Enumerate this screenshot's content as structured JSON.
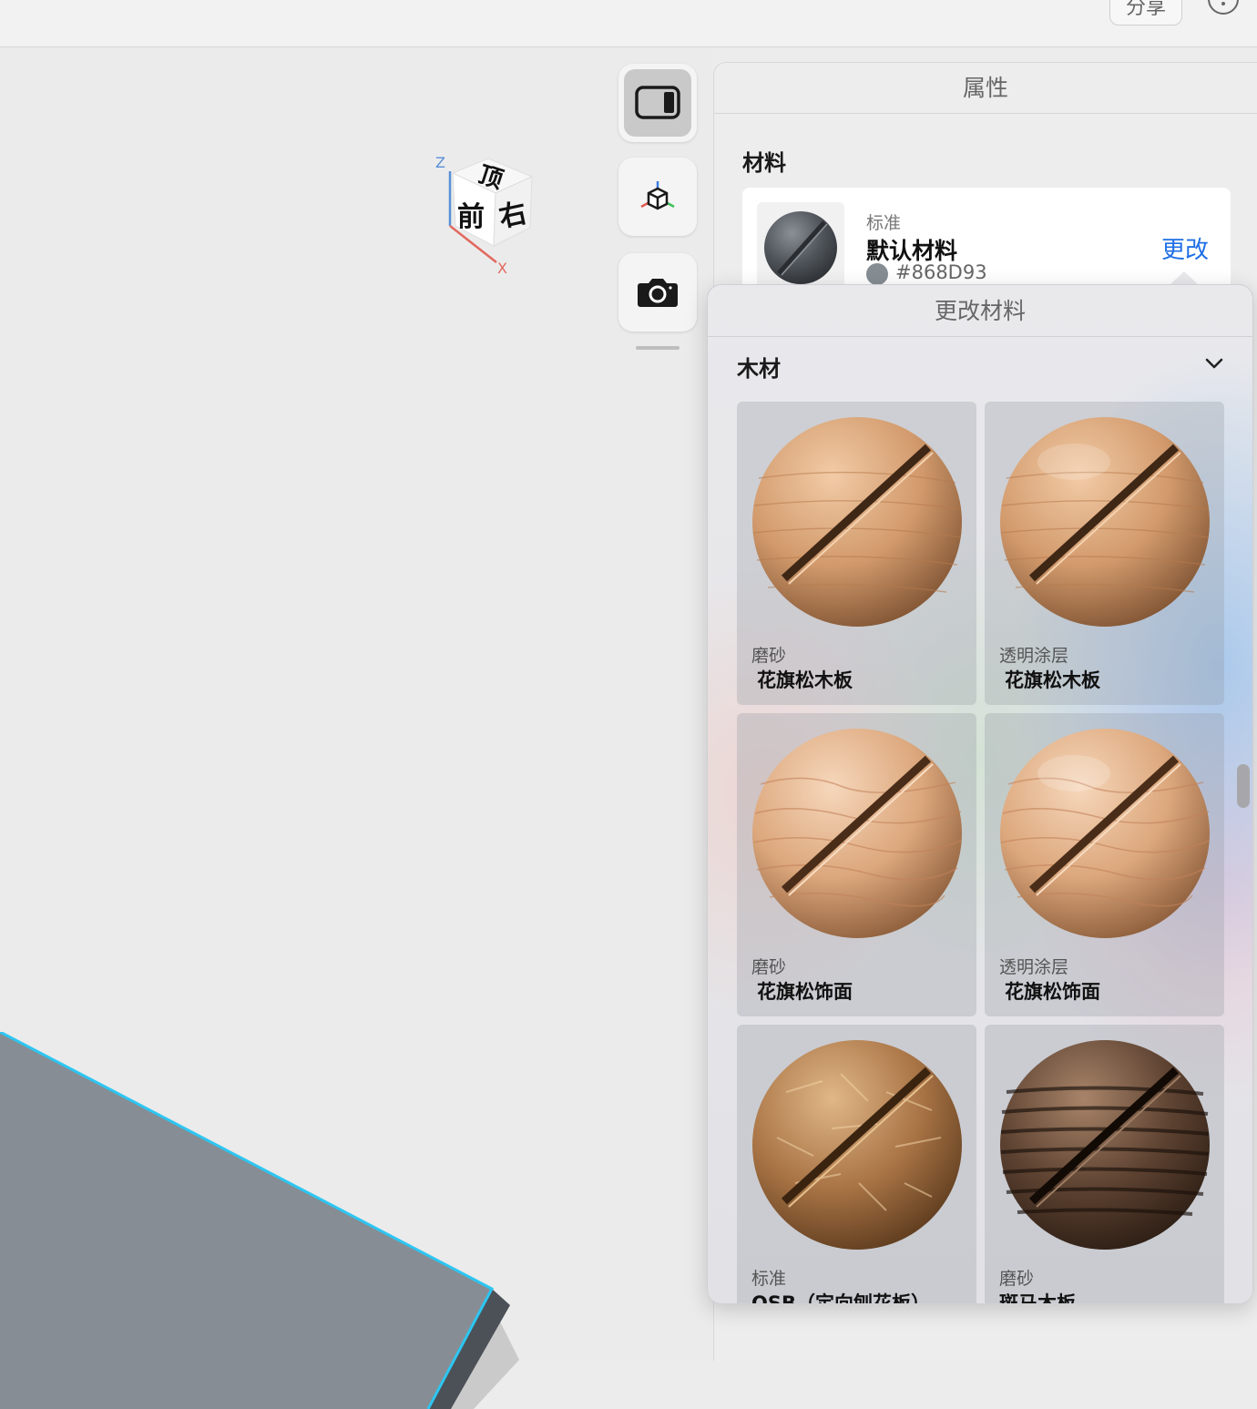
{
  "toolbar": {
    "share_label": "分享"
  },
  "view_cube": {
    "faces": {
      "top": "顶",
      "front": "前",
      "right": "右"
    },
    "axes": {
      "z": "Z",
      "x": "X"
    }
  },
  "tools": {
    "inspector": "sidebar-toggle-icon",
    "transform": "transform-gizmo-icon",
    "capture": "camera-icon"
  },
  "properties": {
    "title": "属性",
    "section": "材料",
    "material": {
      "kind": "标准",
      "name": "默认材料",
      "color_hex": "#868D93",
      "change_label": "更改"
    }
  },
  "change_material": {
    "title": "更改材料",
    "category": "木材",
    "items": [
      {
        "kind": "磨砂",
        "name": "花旗松木板"
      },
      {
        "kind": "透明涂层",
        "name": "花旗松木板"
      },
      {
        "kind": "磨砂",
        "name": "花旗松饰面"
      },
      {
        "kind": "透明涂层",
        "name": "花旗松饰面"
      },
      {
        "kind": "标准",
        "name": "OSB（定向刨花板）"
      },
      {
        "kind": "磨砂",
        "name": "斑马木板"
      }
    ]
  },
  "colors": {
    "accent": "#1f6fe5",
    "selection_edge": "#2cc6f2",
    "floor": "#878d94"
  }
}
